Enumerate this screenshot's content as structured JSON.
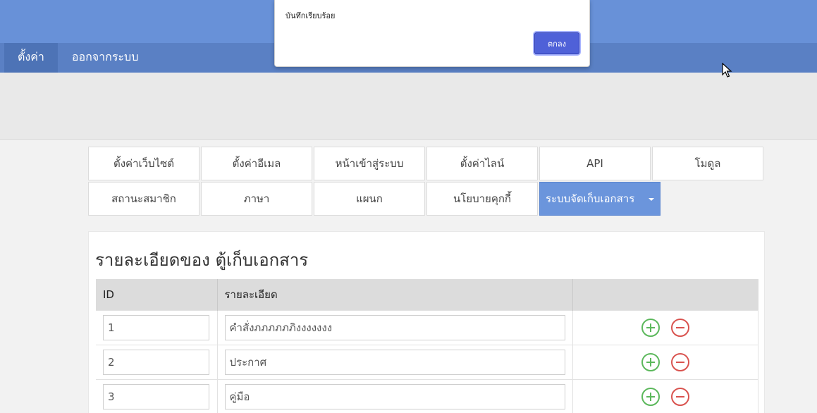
{
  "nav": {
    "settings": "ตั้งค่า",
    "logout": "ออกจากระบบ"
  },
  "tabs": [
    "ตั้งค่าเว็บไซต์",
    "ตั้งค่าอีเมล",
    "หน้าเข้าสู่ระบบ",
    "ตั้งค่าไลน์",
    "API",
    "โมดูล",
    "สถานะสมาชิก",
    "ภาษา",
    "แผนก",
    "นโยบายคุกกี้",
    "ระบบจัดเก็บเอกสาร"
  ],
  "panel": {
    "title": "รายละเอียดของ ตู้เก็บเอกสาร",
    "headers": [
      "ID",
      "รายละเอียด",
      ""
    ],
    "rows": [
      {
        "id": "1",
        "detail": "คำสั่งภภภภภภิงงงงงงง"
      },
      {
        "id": "2",
        "detail": "ประกาศ"
      },
      {
        "id": "3",
        "detail": "คู่มือ"
      }
    ]
  },
  "dialog": {
    "message": "บันทึกเรียบร้อย",
    "ok_label": "ตกลง"
  },
  "colors": {
    "topbar": "#6891d8",
    "navbar": "#5a80c4",
    "active_tab": "#6b95dc",
    "add": "#5cb85c",
    "remove": "#d9534f",
    "ok_button": "#4f61d8"
  },
  "icons": {
    "add": "plus-circle-icon",
    "remove": "minus-circle-icon",
    "dropdown": "caret-down-icon",
    "cursor": "mouse-pointer-icon"
  }
}
